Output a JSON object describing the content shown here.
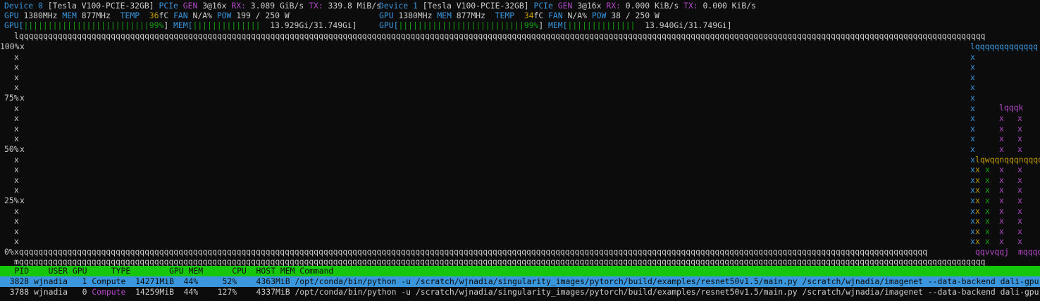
{
  "devices": [
    {
      "name_label": "Device 0",
      "model": "[Tesla V100-PCIE-32GB]",
      "pcie_label": "PCIe",
      "gen_label": "GEN",
      "gen_value": "3@16x",
      "rx_label": "RX:",
      "rx_value": "3.089 GiB/s",
      "tx_label": "TX:",
      "tx_value": "339.8 MiB/s",
      "gpu_label": "GPU",
      "gpu_clock": "1380MHz",
      "mem_label": "MEM",
      "mem_clock": "877MHz",
      "temp_label": "TEMP",
      "temp_value": "36",
      "temp_unit": "fC",
      "fan_label": "FAN",
      "fan_value": "N/A%",
      "pow_label": "POW",
      "pow_value": "199 / 250 W",
      "gpu_bar_label": "GPU[",
      "gpu_bar": "||||||||||||||||||||||||||99%",
      "gpu_util_pct": 99,
      "mem_bar_label": "MEM[",
      "mem_bar": "||||||||||||||",
      "mem_value": "13.929Gi/31.749Gi]"
    },
    {
      "name_label": "Device 1",
      "model": "[Tesla V100-PCIE-32GB]",
      "pcie_label": "PCIe",
      "gen_label": "GEN",
      "gen_value": "3@16x",
      "rx_label": "RX:",
      "rx_value": "0.000 KiB/s",
      "tx_label": "TX:",
      "tx_value": "0.000 KiB/s",
      "gpu_label": "GPU",
      "gpu_clock": "1380MHz",
      "mem_label": "MEM",
      "mem_clock": "877MHz",
      "temp_label": "TEMP",
      "temp_value": "34",
      "temp_unit": "fC",
      "fan_label": "FAN",
      "fan_value": "N/A%",
      "pow_label": "POW",
      "pow_value": "38 / 250 W",
      "gpu_bar_label": "GPU[",
      "gpu_bar": "||||||||||||||||||||||||||99%",
      "gpu_util_pct": 99,
      "mem_bar_label": "MEM[",
      "mem_bar": "||||||||||||||",
      "mem_value": "13.940Gi/31.749Gi]"
    }
  ],
  "graph": {
    "y_ticks": [
      "100%",
      "75%",
      "50%",
      "25%",
      "0%"
    ],
    "border_char_top_left": "l",
    "border_char_bottom_left": "m",
    "border_char_vertical": "x",
    "border_char_horizontal": "q",
    "top_right_fragment": "lqqqqqqqqqqqqq",
    "mid_fragment_purple": "lqqqk",
    "mid_fragment_mixed": "lqwqqnqqqnqqqq",
    "bottom_fragment": "qqvvqqj",
    "bottom_tail": "mqqqq"
  },
  "processes": {
    "headers": [
      "PID",
      "USER",
      "GPU",
      "TYPE",
      "GPU MEM",
      "CPU",
      "HOST MEM",
      "Command"
    ],
    "rows": [
      {
        "pid": "3828",
        "user": "wjnadia",
        "gpu": "1",
        "type": "Compute",
        "gpu_mem": "14271MiB",
        "gpu_mem_pct": "44%",
        "cpu": "52%",
        "host_mem": "4363MiB",
        "command": "/opt/conda/bin/python -u /scratch/wjnadia/singularity_images/pytorch/build/examples/resnet50v1.5/main.py /scratch/wjnadia/imagenet --data-backend dali-gpu --ra"
      },
      {
        "pid": "3788",
        "user": "wjnadia",
        "gpu": "0",
        "type": "Compute",
        "gpu_mem": "14259MiB",
        "gpu_mem_pct": "44%",
        "cpu": "127%",
        "host_mem": "4337MiB",
        "command": "/opt/conda/bin/python -u /scratch/wjnadia/singularity_images/pytorch/build/examples/resnet50v1.5/main.py /scratch/wjnadia/imagenet --data-backend dali-gpu --ra"
      }
    ]
  },
  "colors": {
    "background": "#0c0c0c",
    "cyan": "#3a96dd",
    "magenta": "#b148c6",
    "green": "#16c60c",
    "yellow": "#c19c00",
    "text": "#cccccc"
  }
}
